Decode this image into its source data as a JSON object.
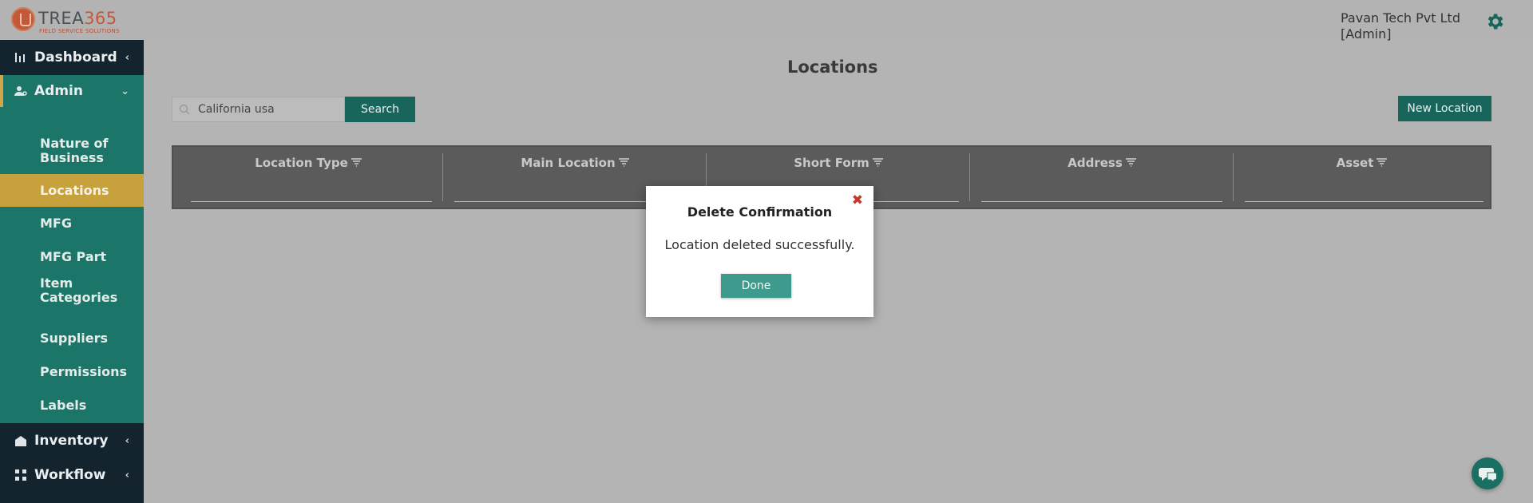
{
  "header": {
    "logo_primary": "TREA",
    "logo_accent": "365",
    "logo_subtitle": "FIELD SERVICE SOLUTIONS",
    "company_name": "Pavan Tech Pvt Ltd",
    "user_role": "[Admin]"
  },
  "sidebar": {
    "dashboard": "Dashboard",
    "admin": "Admin",
    "items": [
      "Nature of Business",
      "Locations",
      "MFG",
      "MFG Part",
      "Item Categories",
      "Suppliers",
      "Permissions",
      "Labels"
    ],
    "active_item": "Locations",
    "inventory": "Inventory",
    "workflow": "Workflow"
  },
  "main": {
    "title": "Locations",
    "search": {
      "value": "California usa",
      "button": "Search"
    },
    "new_button": "New Location",
    "columns": [
      "Location Type",
      "Main Location",
      "Short Form",
      "Address",
      "Asset"
    ]
  },
  "modal": {
    "title": "Delete Confirmation",
    "message": "Location deleted successfully.",
    "close_glyph": "✖",
    "done_label": "Done"
  },
  "colors": {
    "primary": "#18665b",
    "sidebar": "#1b7669",
    "sidebar_dark": "#13242f",
    "active": "#c7a13b",
    "close": "#c0392b"
  }
}
